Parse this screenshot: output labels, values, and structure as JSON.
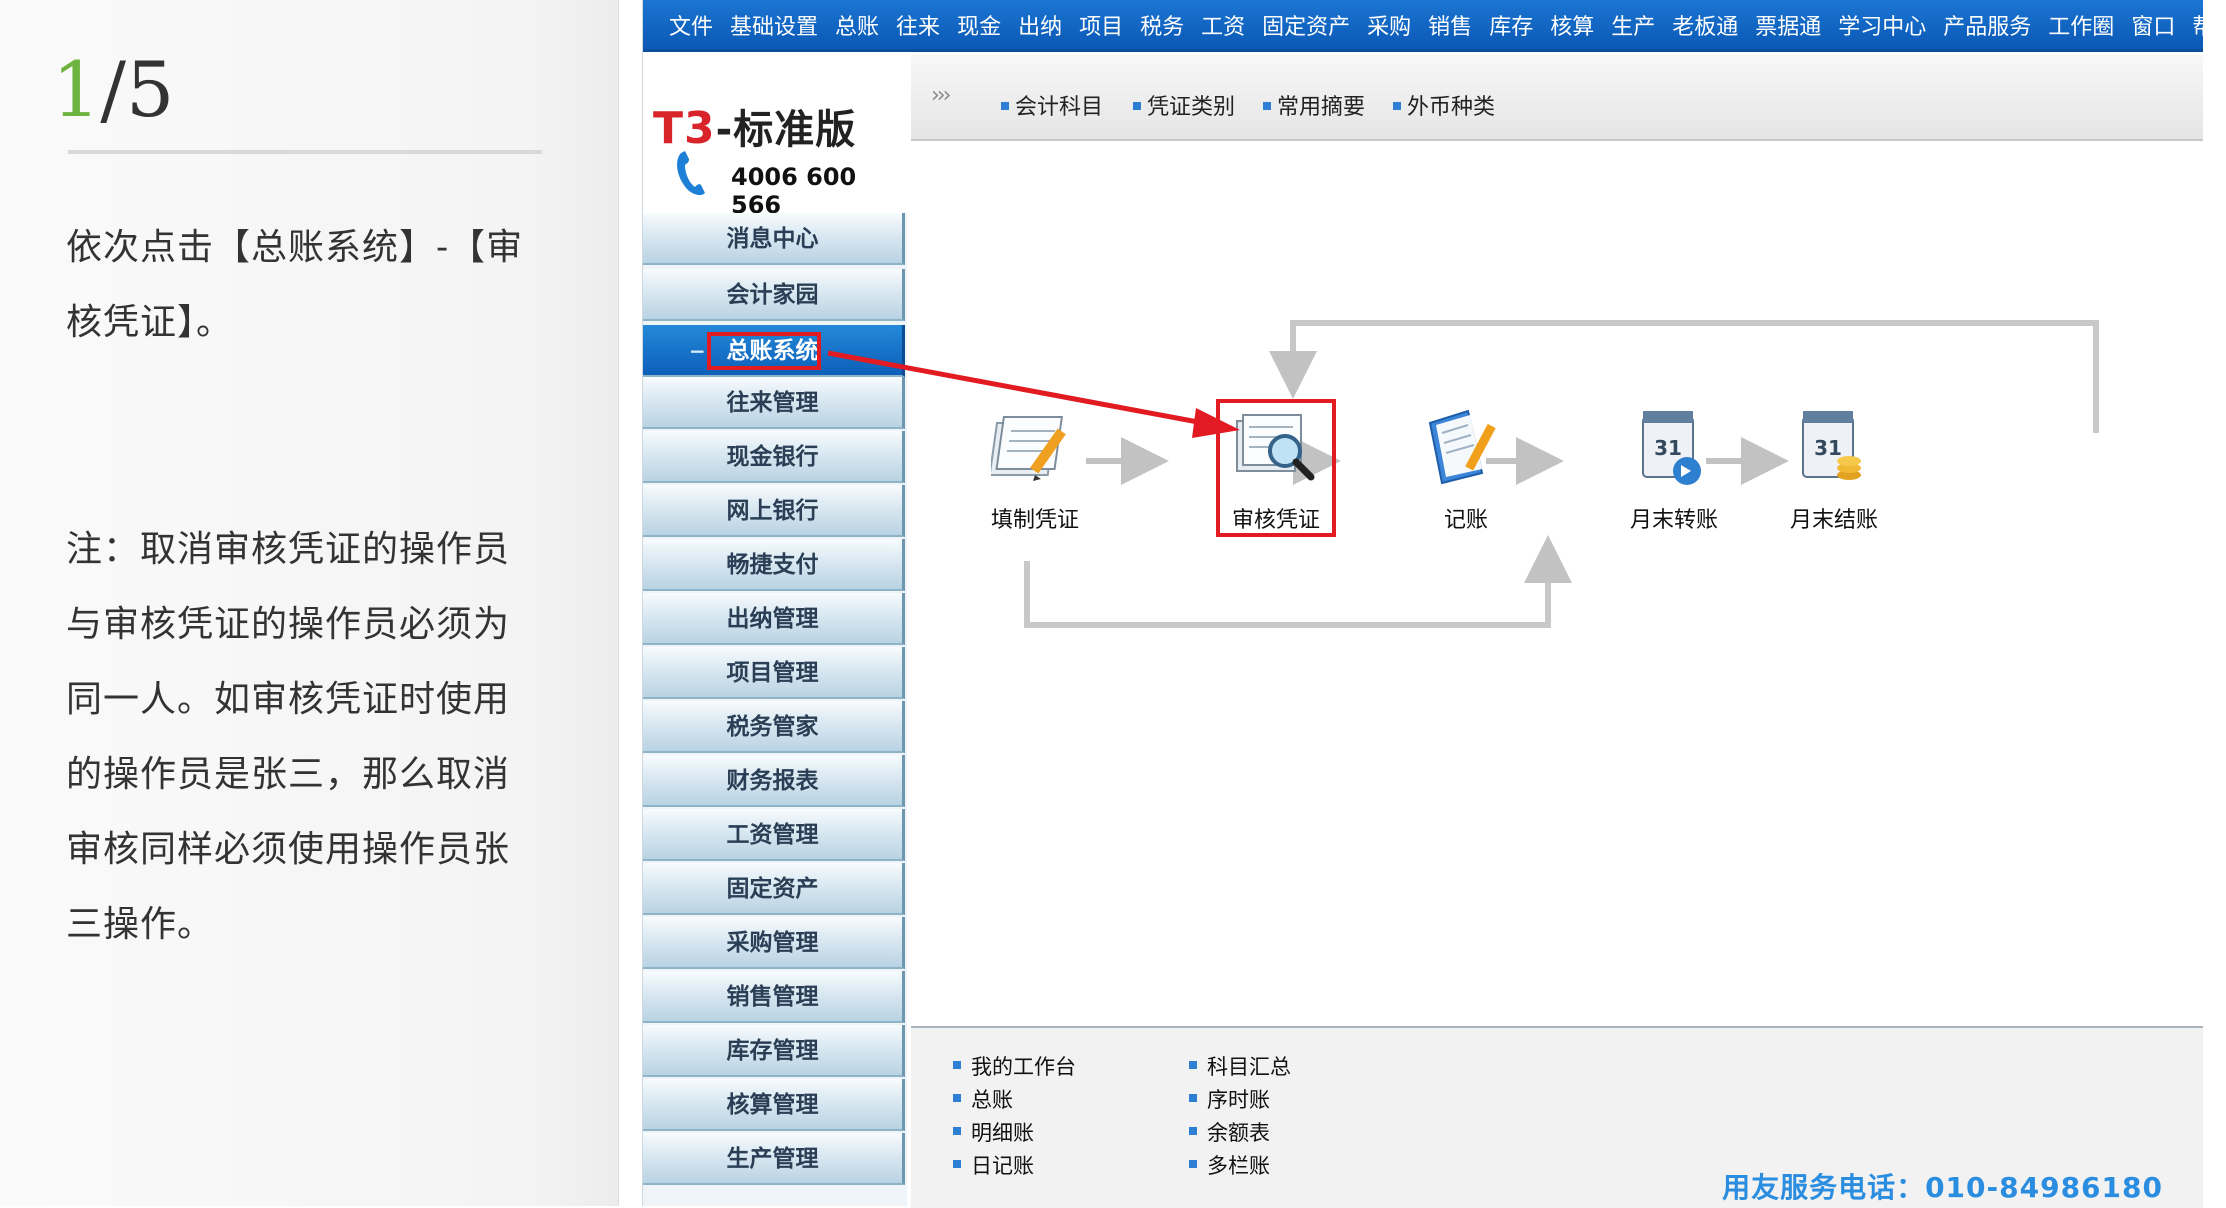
{
  "instruction": {
    "step_current": "1",
    "step_total": "/5",
    "text": "依次点击【总账系统】-【审核凭证】。",
    "note": "注：取消审核凭证的操作员与审核凭证的操作员必须为同一人。如审核凭证时使用的操作员是张三，那么取消审核同样必须使用操作员张三操作。"
  },
  "menubar": [
    "文件",
    "基础设置",
    "总账",
    "往来",
    "现金",
    "出纳",
    "项目",
    "税务",
    "工资",
    "固定资产",
    "采购",
    "销售",
    "库存",
    "核算",
    "生产",
    "老板通",
    "票据通",
    "学习中心",
    "产品服务",
    "工作圈",
    "窗口",
    "帮助"
  ],
  "logo": {
    "brand": "T3",
    "title": "-标准版",
    "phone": "4006 600 566"
  },
  "sidebar": {
    "items": [
      "消息中心",
      "会计家园",
      "总账系统",
      "往来管理",
      "现金银行",
      "网上银行",
      "畅捷支付",
      "出纳管理",
      "项目管理",
      "税务管家",
      "财务报表",
      "工资管理",
      "固定资产",
      "采购管理",
      "销售管理",
      "库存管理",
      "核算管理",
      "生产管理"
    ],
    "active_index": 2
  },
  "toolbar": [
    "会计科目",
    "凭证类别",
    "常用摘要",
    "外币种类"
  ],
  "flow": {
    "nodes": [
      "填制凭证",
      "审核凭证",
      "记账",
      "月末转账",
      "月末结账"
    ],
    "highlighted": "审核凭证"
  },
  "bottom_links": {
    "col1": [
      "我的工作台",
      "总账",
      "明细账",
      "日记账"
    ],
    "col2": [
      "科目汇总",
      "序时账",
      "余额表",
      "多栏账"
    ]
  },
  "service": "用友服务电话：010-84986180",
  "colors": {
    "menubar": "#0b58b5",
    "highlight": "#e21b22",
    "link_square": "#2d7fd3",
    "step_accent": "#6db33f"
  }
}
